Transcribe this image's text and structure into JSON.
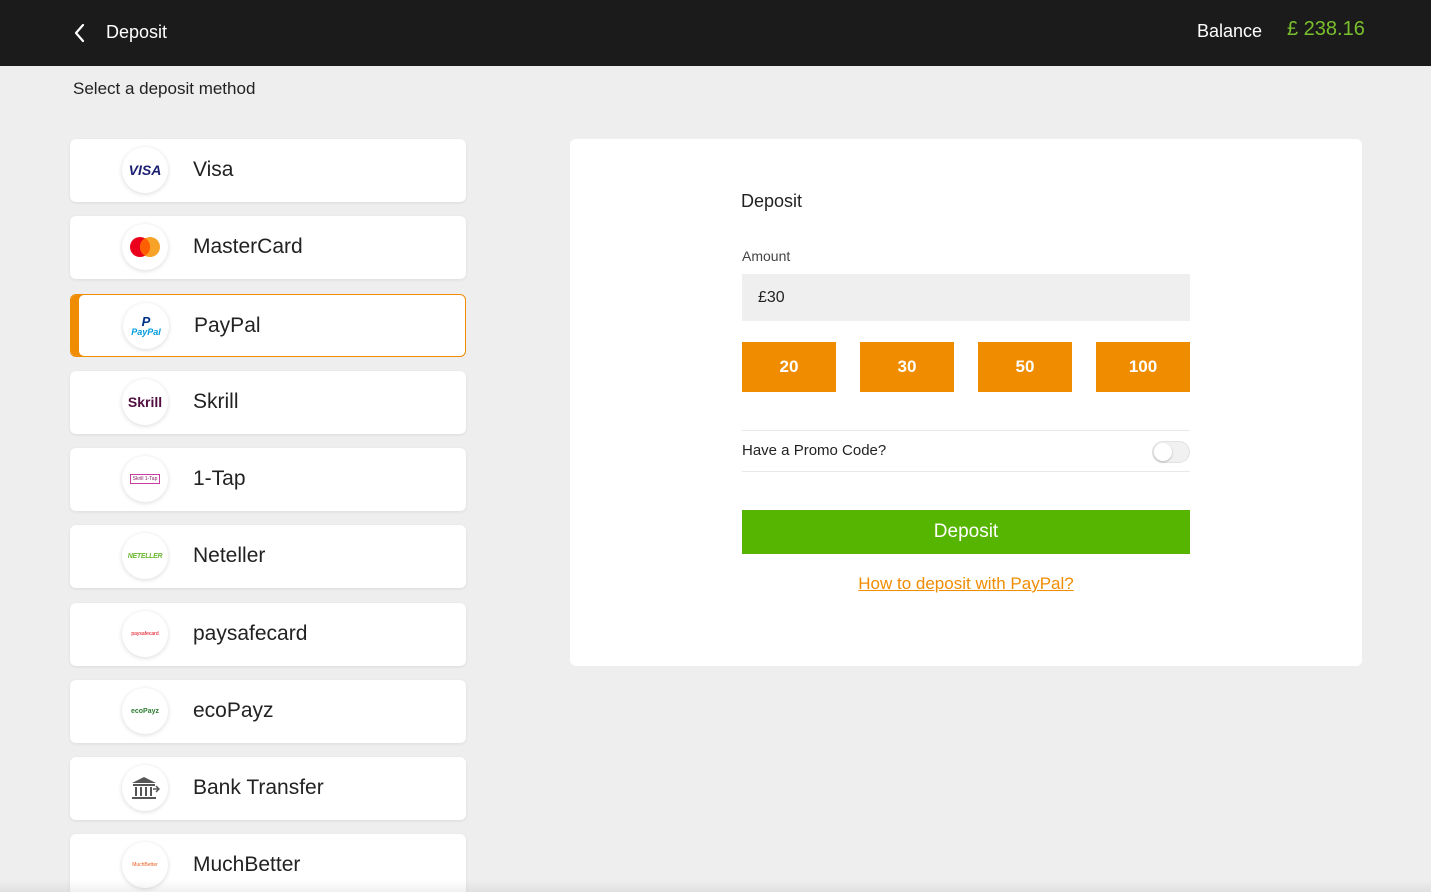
{
  "header": {
    "title": "Deposit",
    "balance_label": "Balance",
    "balance_value": "£ 238.16"
  },
  "subheading": "Select a deposit method",
  "methods": [
    {
      "label": "Visa",
      "icon": "visa-logo-icon"
    },
    {
      "label": "MasterCard",
      "icon": "mastercard-logo-icon"
    },
    {
      "label": "PayPal",
      "icon": "paypal-logo-icon",
      "selected": true
    },
    {
      "label": "Skrill",
      "icon": "skrill-logo-icon"
    },
    {
      "label": "1-Tap",
      "icon": "skrill-1tap-logo-icon"
    },
    {
      "label": "Neteller",
      "icon": "neteller-logo-icon"
    },
    {
      "label": "paysafecard",
      "icon": "paysafecard-logo-icon"
    },
    {
      "label": "ecoPayz",
      "icon": "ecopayz-logo-icon"
    },
    {
      "label": "Bank Transfer",
      "icon": "bank-icon"
    },
    {
      "label": "MuchBetter",
      "icon": "muchbetter-logo-icon"
    }
  ],
  "logo_text": {
    "visa": "VISA",
    "paypal_mark": "P",
    "paypal": "PayPal",
    "skrill": "Skrill",
    "onetap": "Skrill 1-Tap",
    "neteller": "NETELLER",
    "paysafecard": "paysafecard",
    "ecopayz": "ecoPayz",
    "muchbetter": "MuchBetter"
  },
  "deposit_form": {
    "title": "Deposit",
    "amount_label": "Amount",
    "amount_value": "£30",
    "presets": [
      "20",
      "30",
      "50",
      "100"
    ],
    "promo_label": "Have a Promo Code?",
    "promo_enabled": false,
    "submit_label": "Deposit",
    "help_link": "How to deposit with PayPal?"
  },
  "colors": {
    "accent": "#f08c00",
    "success": "#55b500",
    "balance": "#7ac02c",
    "topbar": "#1b1b1b",
    "background": "#eeeeee"
  }
}
